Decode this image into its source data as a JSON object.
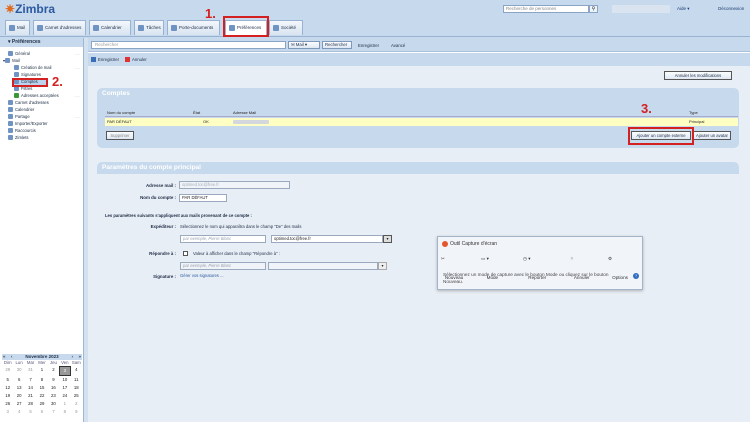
{
  "app": {
    "name": "Zimbra",
    "search_placeholder": "Recherche de personnes",
    "help": "Aide",
    "logout": "Déconnexion"
  },
  "tabs": [
    {
      "label": "Mail"
    },
    {
      "label": "Carnet d'adresses"
    },
    {
      "label": "Calendrier"
    },
    {
      "label": "Tâches"
    },
    {
      "label": "Porte-documents"
    },
    {
      "label": "Préférences"
    },
    {
      "label": "Société"
    }
  ],
  "annotations": {
    "one": "1.",
    "two": "2.",
    "three": "3."
  },
  "sidebar": {
    "title": "Préférences",
    "items": [
      {
        "label": "Général"
      },
      {
        "label": "Mail"
      },
      {
        "label": "Création de mail"
      },
      {
        "label": "Signatures"
      },
      {
        "label": "Comptes"
      },
      {
        "label": "Filtres"
      },
      {
        "label": "Adresses acceptées"
      },
      {
        "label": "Carnet d'adresses"
      },
      {
        "label": "Calendrier"
      },
      {
        "label": "Partage"
      },
      {
        "label": "Importer/Exporter"
      },
      {
        "label": "Raccourcis"
      },
      {
        "label": "Zimlets"
      }
    ],
    "dots": "....."
  },
  "calendar": {
    "month": "Novembre 2023",
    "nav": {
      "prev_year": "«",
      "prev": "‹",
      "next": "›",
      "next_year": "»"
    },
    "days": [
      "Dim",
      "Lun",
      "Mar",
      "Mer",
      "Jeu",
      "Ven",
      "Sam"
    ],
    "weeks": [
      [
        "29",
        "30",
        "31",
        "1",
        "2",
        "3",
        "4"
      ],
      [
        "5",
        "6",
        "7",
        "8",
        "9",
        "10",
        "11"
      ],
      [
        "12",
        "13",
        "14",
        "15",
        "16",
        "17",
        "18"
      ],
      [
        "19",
        "20",
        "21",
        "22",
        "23",
        "24",
        "25"
      ],
      [
        "26",
        "27",
        "28",
        "29",
        "30",
        "1",
        "2"
      ],
      [
        "3",
        "4",
        "5",
        "6",
        "7",
        "8",
        "9"
      ]
    ],
    "today": "3"
  },
  "toolbar": {
    "search_placeholder": "Rechercher",
    "scope": "Mail",
    "search": "Rechercher",
    "save": "Enregistrer",
    "advanced": "Avancé"
  },
  "actions": {
    "save": "Enregistrer",
    "cancel": "Annuler",
    "cancel_mods": "Annuler les modifications"
  },
  "accounts": {
    "title": "Comptes",
    "columns": [
      "Nom du compte",
      "État",
      "Adresse Mail",
      "Type"
    ],
    "row": {
      "name": "PAR DÉFAUT",
      "state": "OK",
      "type": "Principal"
    },
    "delete": "Supprimer",
    "add_external": "Ajouter un compte externe",
    "add_persona": "Ajouter un avatar"
  },
  "primary": {
    "title": "Paramètres du compte principal",
    "email_label": "Adresse mail :",
    "email_value": "optimed.toc@free.fr",
    "account_name_label": "Nom du compte :",
    "account_name_value": "PAR DÉFAUT",
    "info": "Les paramètres suivants s'appliquent aux mails provenant de ce compte :",
    "sender_label": "Expéditeur :",
    "sender_help": "Sélectionnez le nom qui apparaîtra dans le champ \"De\" des mails",
    "sender_placeholder": "par exemple, Pierre Blanc",
    "sender_address": "optimed.toc@free.fr",
    "reply_label": "Répondre à :",
    "reply_help": "Valeur à afficher dans le champ \"Répondre à\" :",
    "reply_placeholder": "par exemple, Pierre Blanc",
    "signature_label": "Signature :",
    "signature_link": "Gérer vos signatures ..."
  },
  "snipping": {
    "title": "Outil Capture d'écran",
    "new": "Nouveau",
    "mode": "Mode",
    "delay": "Reporter",
    "cancel": "Annuler",
    "options": "Options",
    "message": "Sélectionnez un mode de capture avec le bouton Mode ou cliquez sur le bouton Nouveau.",
    "help": "?"
  },
  "colors": {
    "accent": "#c7d9ec",
    "annotation": "#d42020",
    "selected_row": "#ffffc4"
  }
}
